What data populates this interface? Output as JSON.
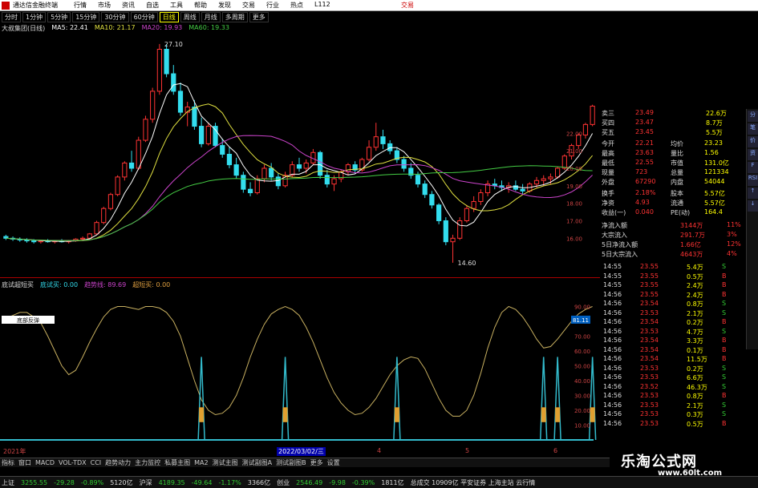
{
  "titlebar": {
    "app": "通达信金融终端",
    "menus": [
      "行情",
      "市场",
      "资讯",
      "自选",
      "工具",
      "帮助",
      "发现",
      "交易",
      "行业",
      "热点",
      "L112"
    ],
    "right": "交易"
  },
  "tabs": [
    "分时",
    "1分钟",
    "5分钟",
    "15分钟",
    "30分钟",
    "60分钟",
    "日线",
    "周线",
    "月线",
    "多周期",
    "更多"
  ],
  "active_tab": "日线",
  "legend": {
    "name": "大叔集团(日线)",
    "ma5": "MA5: 22.41",
    "ma10": "MA10: 21.17",
    "ma20": "MA20: 19.93",
    "ma60": "MA60: 19.33"
  },
  "colors": {
    "up": "#ff3333",
    "down": "#33ddee",
    "ma5": "#ffffff",
    "ma10": "#e0e040",
    "ma20": "#cc44cc",
    "ma60": "#44cc44",
    "ind": "#c8b060"
  },
  "annotations": {
    "high": "27.10",
    "low": "14.60"
  },
  "price_axis": [
    "22.00",
    "21.00",
    "20.00",
    "19.00",
    "18.00",
    "17.00",
    "16.00"
  ],
  "ind_legend": {
    "name": "底试超短买",
    "a": "底试买: 0.00",
    "b": "趋势线: 89.69",
    "c": "超短买: 0.00"
  },
  "ind_axis": [
    "90.00",
    "80.00",
    "70.00",
    "60.00",
    "50.00",
    "40.00",
    "30.00",
    "20.00",
    "10.00"
  ],
  "ind_current": "81.11",
  "ind_tag": "底部反弹",
  "xaxis": {
    "start": "2021年",
    "mid": "2022/03/02/三",
    "ticks": [
      "4",
      "5",
      "6"
    ]
  },
  "quote": [
    [
      "卖三",
      "23.49",
      "22.6万"
    ],
    [
      "买四",
      "23.47",
      "8.7万"
    ],
    [
      "买五",
      "23.45",
      "5.5万"
    ],
    [
      "今开",
      "22.21",
      "均价",
      "23.23"
    ],
    [
      "最高",
      "23.63",
      "量比",
      "1.56"
    ],
    [
      "最低",
      "22.55",
      "市值",
      "131.0亿"
    ],
    [
      "现量",
      "723",
      "总量",
      "121334"
    ],
    [
      "外盘",
      "67290",
      "内盘",
      "54044"
    ],
    [
      "换手",
      "2.18%",
      "股本",
      "5.57亿"
    ],
    [
      "净资",
      "4.93",
      "流通",
      "5.57亿"
    ],
    [
      "收益(一)",
      "0.040",
      "PE(动)",
      "164.4"
    ]
  ],
  "flow": [
    [
      "净流入额",
      "3144万",
      "11%"
    ],
    [
      "大宗流入",
      "291.7万",
      "3%"
    ],
    [
      "5日净流入额",
      "1.66亿",
      "12%"
    ],
    [
      "5日大宗流入",
      "4643万",
      "4%"
    ]
  ],
  "ticks": [
    [
      "14:55",
      "23.55",
      "5.4万",
      "S"
    ],
    [
      "14:55",
      "23.55",
      "0.5万",
      "B"
    ],
    [
      "14:55",
      "23.55",
      "2.4万",
      "B"
    ],
    [
      "14:56",
      "23.55",
      "2.4万",
      "B"
    ],
    [
      "14:56",
      "23.54",
      "0.8万",
      "S"
    ],
    [
      "14:56",
      "23.53",
      "2.1万",
      "S"
    ],
    [
      "14:56",
      "23.54",
      "0.2万",
      "B"
    ],
    [
      "14:56",
      "23.53",
      "4.7万",
      "S"
    ],
    [
      "14:56",
      "23.54",
      "3.3万",
      "B"
    ],
    [
      "14:56",
      "23.54",
      "0.1万",
      "B"
    ],
    [
      "14:56",
      "23.54",
      "11.5万",
      "B"
    ],
    [
      "14:56",
      "23.53",
      "0.2万",
      "S"
    ],
    [
      "14:56",
      "23.53",
      "6.6万",
      "S"
    ],
    [
      "14:56",
      "23.52",
      "46.3万",
      "S"
    ],
    [
      "14:56",
      "23.53",
      "0.8万",
      "B"
    ],
    [
      "14:56",
      "23.53",
      "2.1万",
      "S"
    ],
    [
      "14:56",
      "23.53",
      "0.3万",
      "S"
    ],
    [
      "14:56",
      "23.53",
      "0.5万",
      "B"
    ]
  ],
  "indtoolbar": [
    "指标",
    "窗口",
    "MACD",
    "VOL-TDX",
    "CCI",
    "趋势动力",
    "主力监控",
    "私募主图",
    "MA2",
    "测试主图",
    "测试副图A",
    "测试副图B",
    "更多",
    "设置"
  ],
  "statusbar": [
    {
      "name": "上证",
      "v": "3255.55",
      "c": "-29.28",
      "p": "-0.89%",
      "a": "5120亿"
    },
    {
      "name": "沪深",
      "v": "4189.35",
      "c": "-49.64",
      "p": "-1.17%",
      "a": "3366亿"
    },
    {
      "name": "创业",
      "v": "2546.49",
      "c": "-9.98",
      "p": "-0.39%",
      "a": "1811亿"
    }
  ],
  "status_extra": "总成交 10909亿 平安证券 上海主站 云行情",
  "watermark": {
    "title": "乐淘公式网",
    "url": "www.60lt.com"
  },
  "sidebar": [
    "分",
    "笔",
    "价",
    "资",
    "F",
    "RSI",
    "↑",
    "↓"
  ],
  "chart_data": {
    "type": "candlestick",
    "candles": [
      [
        16.1,
        16.2,
        15.9,
        16.0
      ],
      [
        16.0,
        16.1,
        15.85,
        15.95
      ],
      [
        15.95,
        16.05,
        15.8,
        15.9
      ],
      [
        15.9,
        16.0,
        15.75,
        15.85
      ],
      [
        15.85,
        15.95,
        15.7,
        15.8
      ],
      [
        15.8,
        15.9,
        15.7,
        15.85
      ],
      [
        15.85,
        15.95,
        15.75,
        15.8
      ],
      [
        15.8,
        15.9,
        15.7,
        15.85
      ],
      [
        15.85,
        15.95,
        15.75,
        15.8
      ],
      [
        15.8,
        15.9,
        15.7,
        15.85
      ],
      [
        15.85,
        16.0,
        15.8,
        15.95
      ],
      [
        15.95,
        16.1,
        15.85,
        16.0
      ],
      [
        16.0,
        16.3,
        15.95,
        16.25
      ],
      [
        16.25,
        17.0,
        16.2,
        16.9
      ],
      [
        16.9,
        17.8,
        16.8,
        17.7
      ],
      [
        17.7,
        18.6,
        17.6,
        18.5
      ],
      [
        18.5,
        19.6,
        18.4,
        19.5
      ],
      [
        19.5,
        20.4,
        19.3,
        20.3
      ],
      [
        20.3,
        21.0,
        19.8,
        20.0
      ],
      [
        20.0,
        21.8,
        19.9,
        21.6
      ],
      [
        21.6,
        23.0,
        21.5,
        22.8
      ],
      [
        22.8,
        24.6,
        22.6,
        24.4
      ],
      [
        24.4,
        27.1,
        24.2,
        26.8
      ],
      [
        26.8,
        27.1,
        25.2,
        25.4
      ],
      [
        25.4,
        25.9,
        24.2,
        24.4
      ],
      [
        24.4,
        24.9,
        23.0,
        23.2
      ],
      [
        23.2,
        23.8,
        22.4,
        23.5
      ],
      [
        23.5,
        23.9,
        22.2,
        22.4
      ],
      [
        22.4,
        22.9,
        21.2,
        21.4
      ],
      [
        21.4,
        22.6,
        21.3,
        22.4
      ],
      [
        22.4,
        22.6,
        21.2,
        21.3
      ],
      [
        21.3,
        21.7,
        20.6,
        20.8
      ],
      [
        20.8,
        21.2,
        20.0,
        20.2
      ],
      [
        20.2,
        20.6,
        19.4,
        19.6
      ],
      [
        19.6,
        19.8,
        18.6,
        18.8
      ],
      [
        18.8,
        19.2,
        18.4,
        18.6
      ],
      [
        18.6,
        19.6,
        18.5,
        19.4
      ],
      [
        19.4,
        20.2,
        19.2,
        20.0
      ],
      [
        20.0,
        20.3,
        19.3,
        19.5
      ],
      [
        19.5,
        19.7,
        18.8,
        19.0
      ],
      [
        19.0,
        19.8,
        18.9,
        19.6
      ],
      [
        19.6,
        20.4,
        19.5,
        20.2
      ],
      [
        20.2,
        20.6,
        19.8,
        20.0
      ],
      [
        20.0,
        20.5,
        19.7,
        20.3
      ],
      [
        20.3,
        21.1,
        20.2,
        20.9
      ],
      [
        20.9,
        21.0,
        19.4,
        19.6
      ],
      [
        19.6,
        19.9,
        18.9,
        19.1
      ],
      [
        19.1,
        19.6,
        18.7,
        19.4
      ],
      [
        19.4,
        19.9,
        19.2,
        19.8
      ],
      [
        19.8,
        20.3,
        19.6,
        20.2
      ],
      [
        20.2,
        20.4,
        19.7,
        19.9
      ],
      [
        19.9,
        20.6,
        19.8,
        20.5
      ],
      [
        20.5,
        21.6,
        20.4,
        21.2
      ],
      [
        21.2,
        22.6,
        21.0,
        21.8
      ],
      [
        21.8,
        22.2,
        21.1,
        21.4
      ],
      [
        21.4,
        21.6,
        20.8,
        21.0
      ],
      [
        21.0,
        21.2,
        20.3,
        20.5
      ],
      [
        20.5,
        20.7,
        19.8,
        20.0
      ],
      [
        20.0,
        20.3,
        19.4,
        19.6
      ],
      [
        19.6,
        19.8,
        18.9,
        19.1
      ],
      [
        19.1,
        19.3,
        18.3,
        18.5
      ],
      [
        18.5,
        18.7,
        17.7,
        17.9
      ],
      [
        17.9,
        18.0,
        16.8,
        17.0
      ],
      [
        17.0,
        17.2,
        15.6,
        15.8
      ],
      [
        15.8,
        16.2,
        14.6,
        16.0
      ],
      [
        16.0,
        17.2,
        15.9,
        17.0
      ],
      [
        17.0,
        17.9,
        16.9,
        17.7
      ],
      [
        17.7,
        18.4,
        17.5,
        18.1
      ],
      [
        18.1,
        18.8,
        17.9,
        18.6
      ],
      [
        18.6,
        19.3,
        18.4,
        19.1
      ],
      [
        19.1,
        19.4,
        18.8,
        19.0
      ],
      [
        19.0,
        19.3,
        18.7,
        18.9
      ],
      [
        18.9,
        19.2,
        18.6,
        19.0
      ],
      [
        19.0,
        19.3,
        18.7,
        18.8
      ],
      [
        18.8,
        19.1,
        18.5,
        18.7
      ],
      [
        18.7,
        19.2,
        18.6,
        19.1
      ],
      [
        19.1,
        19.5,
        18.9,
        19.3
      ],
      [
        19.3,
        19.6,
        19.0,
        19.4
      ],
      [
        19.4,
        19.7,
        19.1,
        19.5
      ],
      [
        19.5,
        20.1,
        19.4,
        20.0
      ],
      [
        20.0,
        20.8,
        19.9,
        20.7
      ],
      [
        20.7,
        21.4,
        20.5,
        21.3
      ],
      [
        21.3,
        22.0,
        21.1,
        21.9
      ],
      [
        21.9,
        22.6,
        21.7,
        22.5
      ],
      [
        22.5,
        23.63,
        22.4,
        23.55
      ]
    ],
    "indicator": [
      82,
      84,
      86,
      86,
      83,
      79,
      70,
      60,
      50,
      44,
      47,
      56,
      66,
      75,
      83,
      88,
      90,
      90,
      89,
      88,
      90,
      90,
      89,
      86,
      80,
      70,
      55,
      40,
      27,
      20,
      17,
      18,
      22,
      30,
      42,
      56,
      68,
      78,
      85,
      88,
      90,
      88,
      84,
      76,
      66,
      54,
      42,
      32,
      25,
      20,
      17,
      18,
      22,
      28,
      36,
      44,
      50,
      54,
      56,
      55,
      48,
      38,
      28,
      20,
      16,
      16,
      20,
      30,
      45,
      62,
      76,
      86,
      90,
      88,
      83,
      76,
      68,
      62,
      63,
      68,
      74,
      80,
      85,
      88,
      90
    ],
    "signals": [
      28,
      40,
      56,
      77,
      79,
      84
    ]
  }
}
